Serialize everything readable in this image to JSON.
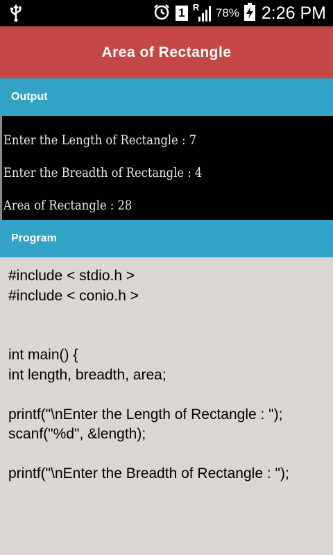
{
  "status_bar": {
    "battery_pct": "78%",
    "sim_slot": "1",
    "signal_label": "R",
    "time": "2:26 PM",
    "icons": [
      "usb-icon",
      "alarm-icon",
      "sim-icon",
      "signal-icon",
      "battery-charging-icon"
    ]
  },
  "app_bar": {
    "title": "Area of Rectangle"
  },
  "output": {
    "header": "Output",
    "lines": [
      "Enter the Length of Rectangle : 7",
      "Enter the Breadth of Rectangle : 4",
      "Area of Rectangle : 28"
    ]
  },
  "program": {
    "header": "Program",
    "code": [
      "#include < stdio.h >",
      "#include < conio.h >",
      "int main() {",
      "int length, breadth, area;",
      "printf(\"\\nEnter the Length of Rectangle : \");",
      "scanf(\"%d\", &length);",
      "printf(\"\\nEnter the Breadth of Rectangle : \");"
    ]
  },
  "colors": {
    "app_bar": "#c44745",
    "section_header": "#32a2c7",
    "background": "#dad7d3",
    "console": "#000000"
  }
}
